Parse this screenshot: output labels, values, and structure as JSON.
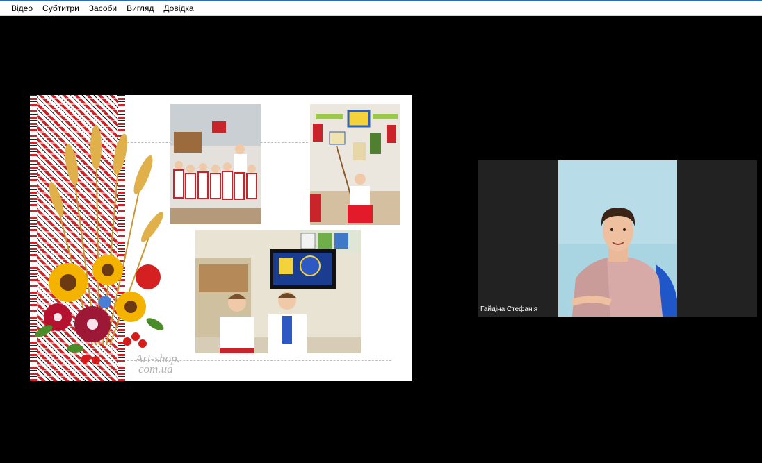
{
  "menu": {
    "items": [
      "Відео",
      "Субтитри",
      "Засоби",
      "Вигляд",
      "Довідка"
    ]
  },
  "slide": {
    "watermark_line1": "Art-shop.",
    "watermark_line2": "com.ua"
  },
  "participant": {
    "name": "Гайдіна Стефанія"
  },
  "colors": {
    "background": "#000000",
    "menubar": "#ffffff",
    "accent_line": "#1a73c8",
    "tile_background": "#222222",
    "embroidery_red": "#c8242a"
  }
}
